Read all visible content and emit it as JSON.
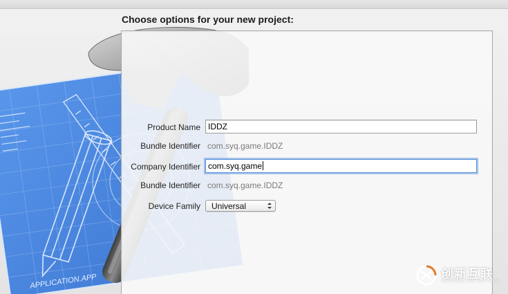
{
  "dialog": {
    "heading": "Choose options for your new project:"
  },
  "form": {
    "product_name": {
      "label": "Product Name",
      "value": "IDDZ"
    },
    "bundle_identifier_1": {
      "label": "Bundle Identifier",
      "value": "com.syq.game.IDDZ"
    },
    "company_identifier": {
      "label": "Company Identifier",
      "value": "com.syq.game"
    },
    "bundle_identifier_2": {
      "label": "Bundle Identifier",
      "value": "com.syq.game.IDDZ"
    },
    "device_family": {
      "label": "Device Family",
      "selected": "Universal"
    }
  },
  "illustration": {
    "blueprint_text": "APPLICATION.APP",
    "icon": "xcode-hammer-blueprint-icon"
  },
  "watermark": {
    "text": "创新互联",
    "subtext": "CHUANG XIN HU LIAN",
    "icon": "chuangxin-logo-icon"
  },
  "colors": {
    "background": "#ececec",
    "blueprint": "#4a87e0",
    "focus_ring": "#689be4",
    "label": "#1f1f1f",
    "static_value": "#7a7a7a"
  }
}
